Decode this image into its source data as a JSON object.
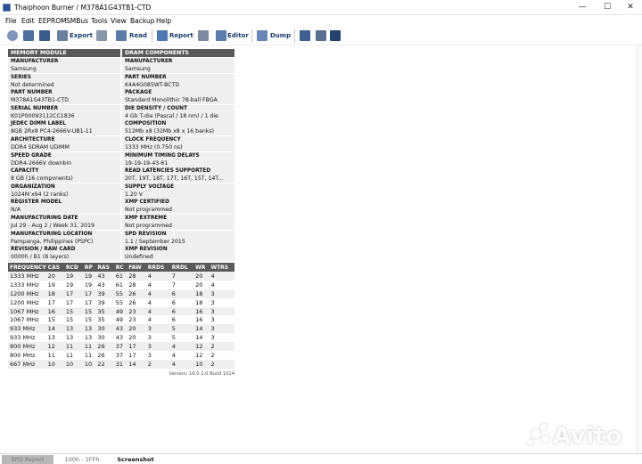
{
  "window": {
    "title": "Thaiphoon Burner / M378A1G43TB1-CTD",
    "controls": [
      "—",
      "☐",
      "✕"
    ]
  },
  "menu": [
    "File",
    "Edit",
    "EEPROM",
    "SMBus",
    "Tools",
    "View",
    "Backup",
    "Help"
  ],
  "toolbar": {
    "export_label": "Export",
    "read_label": "Read",
    "report_label": "Report",
    "editor_label": "Editor",
    "dump_label": "Dump"
  },
  "memory_module": {
    "header": "MEMORY MODULE",
    "fields": [
      {
        "label": "MANUFACTURER",
        "value": "Samsung"
      },
      {
        "label": "SERIES",
        "value": "Not determined"
      },
      {
        "label": "PART NUMBER",
        "value": "M378A1G43TB1-CTD"
      },
      {
        "label": "SERIAL NUMBER",
        "value": "K01P00093112CC1836"
      },
      {
        "label": "JEDEC DIMM LABEL",
        "value": "8GB 2Rx8 PC4-2666V-UB1-11"
      },
      {
        "label": "ARCHITECTURE",
        "value": "DDR4 SDRAM UDIMM"
      },
      {
        "label": "SPEED GRADE",
        "value": "DDR4-2666V downbin"
      },
      {
        "label": "CAPACITY",
        "value": "8 GB (16 components)"
      },
      {
        "label": "ORGANIZATION",
        "value": "1024M x64 (2 ranks)"
      },
      {
        "label": "REGISTER MODEL",
        "value": "N/A"
      },
      {
        "label": "MANUFACTURING DATE",
        "value": "Jul 29 - Aug 2 / Week 31, 2019"
      },
      {
        "label": "MANUFACTURING LOCATION",
        "value": "Pampanga, Philippines (PSPC)"
      },
      {
        "label": "REVISION / RAW CARD",
        "value": "0000h / B1 (8 layers)"
      }
    ]
  },
  "dram_components": {
    "header": "DRAM COMPONENTS",
    "fields": [
      {
        "label": "MANUFACTURER",
        "value": "Samsung"
      },
      {
        "label": "PART NUMBER",
        "value": "K4A4G085WT-BCTD"
      },
      {
        "label": "PACKAGE",
        "value": "Standard Monolithic 78-ball FBGA"
      },
      {
        "label": "DIE DENSITY / COUNT",
        "value": "4 Gb T-die (Pascal / 18 nm) / 1 die"
      },
      {
        "label": "COMPOSITION",
        "value": "512Mb x8 (32Mb x8 x 16 banks)"
      },
      {
        "label": "CLOCK FREQUENCY",
        "value": "1333 MHz (0.750 ns)"
      },
      {
        "label": "MINIMUM TIMING DELAYS",
        "value": "19-19-19-43-61"
      },
      {
        "label": "READ LATENCIES SUPPORTED",
        "value": "20T, 19T, 18T, 17T, 16T, 15T, 14T..."
      },
      {
        "label": "SUPPLY VOLTAGE",
        "value": "1.20 V"
      },
      {
        "label": "XMP CERTIFIED",
        "value": "Not programmed"
      },
      {
        "label": "XMP EXTREME",
        "value": "Not programmed"
      },
      {
        "label": "SPD REVISION",
        "value": "1.1 / September 2015"
      },
      {
        "label": "XMP REVISION",
        "value": "Undefined"
      }
    ]
  },
  "timings": {
    "columns": [
      "FREQUENCY",
      "CAS",
      "RCD",
      "RP",
      "RAS",
      "RC",
      "FAW",
      "RRDS",
      "RRDL",
      "WR",
      "WTRS"
    ],
    "rows": [
      [
        "1333 MHz",
        "20",
        "19",
        "19",
        "43",
        "61",
        "28",
        "4",
        "7",
        "20",
        "4"
      ],
      [
        "1333 MHz",
        "19",
        "19",
        "19",
        "43",
        "61",
        "28",
        "4",
        "7",
        "20",
        "4"
      ],
      [
        "1200 MHz",
        "18",
        "17",
        "17",
        "39",
        "55",
        "26",
        "4",
        "6",
        "18",
        "3"
      ],
      [
        "1200 MHz",
        "17",
        "17",
        "17",
        "39",
        "55",
        "26",
        "4",
        "6",
        "18",
        "3"
      ],
      [
        "1067 MHz",
        "16",
        "15",
        "15",
        "35",
        "49",
        "23",
        "4",
        "6",
        "16",
        "3"
      ],
      [
        "1067 MHz",
        "15",
        "15",
        "15",
        "35",
        "49",
        "23",
        "4",
        "6",
        "16",
        "3"
      ],
      [
        "933 MHz",
        "14",
        "13",
        "13",
        "30",
        "43",
        "20",
        "3",
        "5",
        "14",
        "3"
      ],
      [
        "933 MHz",
        "13",
        "13",
        "13",
        "30",
        "43",
        "20",
        "3",
        "5",
        "14",
        "3"
      ],
      [
        "800 MHz",
        "12",
        "11",
        "11",
        "26",
        "37",
        "17",
        "3",
        "4",
        "12",
        "2"
      ],
      [
        "800 MHz",
        "11",
        "11",
        "11",
        "26",
        "37",
        "17",
        "3",
        "4",
        "12",
        "2"
      ],
      [
        "667 MHz",
        "10",
        "10",
        "10",
        "22",
        "31",
        "14",
        "2",
        "4",
        "10",
        "2"
      ]
    ]
  },
  "version_text": "Version: 16.0.1.0 Build 1014",
  "tabs": [
    "SPD Report",
    "100h - 1FFh",
    "Screenshot"
  ],
  "watermark": "Avito"
}
